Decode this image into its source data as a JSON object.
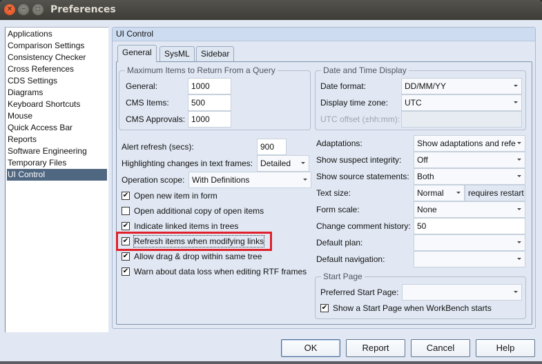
{
  "window": {
    "title": "Preferences",
    "controls": {
      "close": "close-icon",
      "minimize": "minimize-icon",
      "maximize": "maximize-icon"
    }
  },
  "nav": {
    "items": [
      {
        "label": "Applications",
        "selected": false
      },
      {
        "label": "Comparison Settings",
        "selected": false
      },
      {
        "label": "Consistency Checker",
        "selected": false
      },
      {
        "label": "Cross References",
        "selected": false
      },
      {
        "label": "CDS Settings",
        "selected": false
      },
      {
        "label": "Diagrams",
        "selected": false
      },
      {
        "label": "Keyboard Shortcuts",
        "selected": false
      },
      {
        "label": "Mouse",
        "selected": false
      },
      {
        "label": "Quick Access Bar",
        "selected": false
      },
      {
        "label": "Reports",
        "selected": false
      },
      {
        "label": "Software Engineering",
        "selected": false
      },
      {
        "label": "Temporary Files",
        "selected": false
      },
      {
        "label": "UI Control",
        "selected": true
      }
    ]
  },
  "panel": {
    "title": "UI Control",
    "tabs": [
      {
        "label": "General",
        "active": true
      },
      {
        "label": "SysML",
        "active": false
      },
      {
        "label": "Sidebar",
        "active": false
      }
    ]
  },
  "query_group": {
    "legend": "Maximum Items to Return From a Query",
    "general": {
      "label": "General:",
      "value": "1000"
    },
    "cms_items": {
      "label": "CMS Items:",
      "value": "500"
    },
    "cms_approvals": {
      "label": "CMS Approvals:",
      "value": "1000"
    }
  },
  "datetime_group": {
    "legend": "Date and Time Display",
    "date_format": {
      "label": "Date format:",
      "value": "DD/MM/YY"
    },
    "time_zone": {
      "label": "Display time zone:",
      "value": "UTC"
    },
    "utc_offset": {
      "label": "UTC offset (±hh:mm):",
      "value": ""
    }
  },
  "general": {
    "alert_refresh": {
      "label": "Alert refresh (secs):",
      "value": "900"
    },
    "highlighting": {
      "label": "Highlighting changes in text frames:",
      "value": "Detailed"
    },
    "operation_scope": {
      "label": "Operation scope:",
      "value": "With Definitions"
    },
    "checkboxes": [
      {
        "label": "Open new item in form",
        "checked": true
      },
      {
        "label": "Open additional copy of open items",
        "checked": false
      },
      {
        "label": "Indicate linked items in trees",
        "checked": true
      },
      {
        "label": "Refresh items when modifying links",
        "checked": true
      },
      {
        "label": "Allow drag & drop within same tree",
        "checked": true
      },
      {
        "label": "Warn about data loss when editing RTF frames",
        "checked": true
      }
    ],
    "check_mark": "✔"
  },
  "right": {
    "adaptations": {
      "label": "Adaptations:",
      "value": "Show adaptations and refe"
    },
    "suspect_integrity": {
      "label": "Show suspect integrity:",
      "value": "Off"
    },
    "source_statements": {
      "label": "Show source statements:",
      "value": "Both"
    },
    "text_size": {
      "label": "Text size:",
      "value": "Normal",
      "note": "requires restart"
    },
    "form_scale": {
      "label": "Form scale:",
      "value": "None"
    },
    "comment_history": {
      "label": "Change comment history:",
      "value": "50"
    },
    "default_plan": {
      "label": "Default plan:",
      "value": ""
    },
    "default_navigation": {
      "label": "Default navigation:",
      "value": ""
    }
  },
  "start_page": {
    "legend": "Start Page",
    "preferred": {
      "label": "Preferred Start Page:",
      "value": ""
    },
    "show_start": {
      "label": "Show a Start Page when WorkBench starts",
      "checked": true
    }
  },
  "buttons": {
    "ok": "OK",
    "report": "Report",
    "cancel": "Cancel",
    "help": "Help"
  },
  "annotation": {
    "highlight_color": "#e0202a",
    "highlighted_item": "Refresh items when modifying links"
  }
}
